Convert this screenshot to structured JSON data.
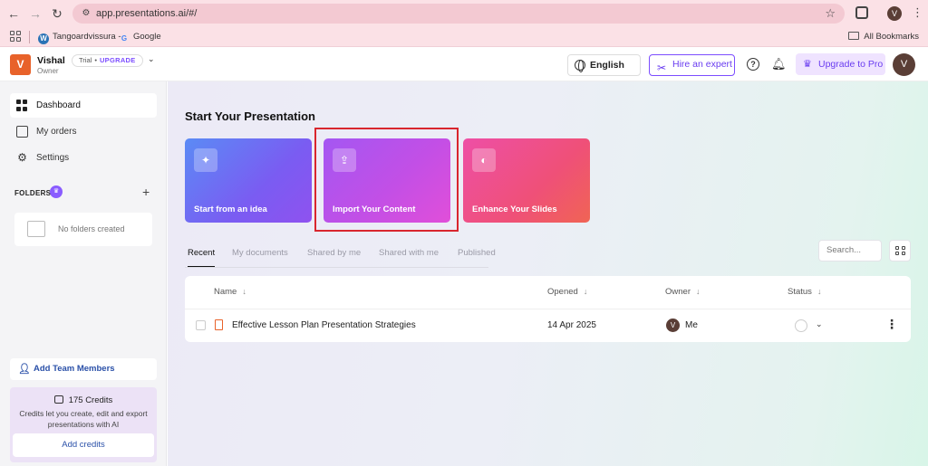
{
  "browser": {
    "url": "app.presentations.ai/#/",
    "profile_initial": "V",
    "bookmarks": [
      {
        "label": "Tangoardvissura -"
      },
      {
        "label": "Google"
      }
    ],
    "all_bookmarks_label": "All Bookmarks"
  },
  "header": {
    "workspace_initial": "V",
    "workspace_name": "Vishal",
    "workspace_role": "Owner",
    "plan_label": "Trial",
    "plan_separator": "•",
    "plan_upgrade": "UPGRADE",
    "language": "English",
    "hire_expert": "Hire an expert",
    "upgrade_pro": "Upgrade to Pro",
    "avatar_initial": "V"
  },
  "sidebar": {
    "items": [
      {
        "label": "Dashboard",
        "icon": "dashboard-icon"
      },
      {
        "label": "My orders",
        "icon": "orders-icon"
      },
      {
        "label": "Settings",
        "icon": "gear-icon"
      }
    ],
    "folders_label": "FOLDERS",
    "no_folders": "No folders created",
    "add_team": "Add Team Members",
    "credits_title": "175 Credits",
    "credits_desc": "Credits let you create, edit and export presentations with AI",
    "add_credits": "Add credits"
  },
  "main": {
    "title": "Start Your Presentation",
    "cards": [
      {
        "label": "Start from an idea",
        "icon": "sparkle-icon"
      },
      {
        "label": "Import Your Content",
        "icon": "upload-file-icon"
      },
      {
        "label": "Enhance Your Slides",
        "icon": "powerpoint-icon"
      }
    ],
    "tabs": [
      "Recent",
      "My documents",
      "Shared by me",
      "Shared with me",
      "Published"
    ],
    "search_placeholder": "Search...",
    "table": {
      "columns": [
        "Name",
        "Opened",
        "Owner",
        "Status"
      ],
      "rows": [
        {
          "name": "Effective Lesson Plan Presentation Strategies",
          "opened": "14 Apr 2025",
          "owner_initial": "V",
          "owner": "Me"
        }
      ]
    }
  },
  "colors": {
    "accent": "#7c4dff",
    "workspace_logo": "#e8622a",
    "highlight_border": "#d9262e"
  }
}
